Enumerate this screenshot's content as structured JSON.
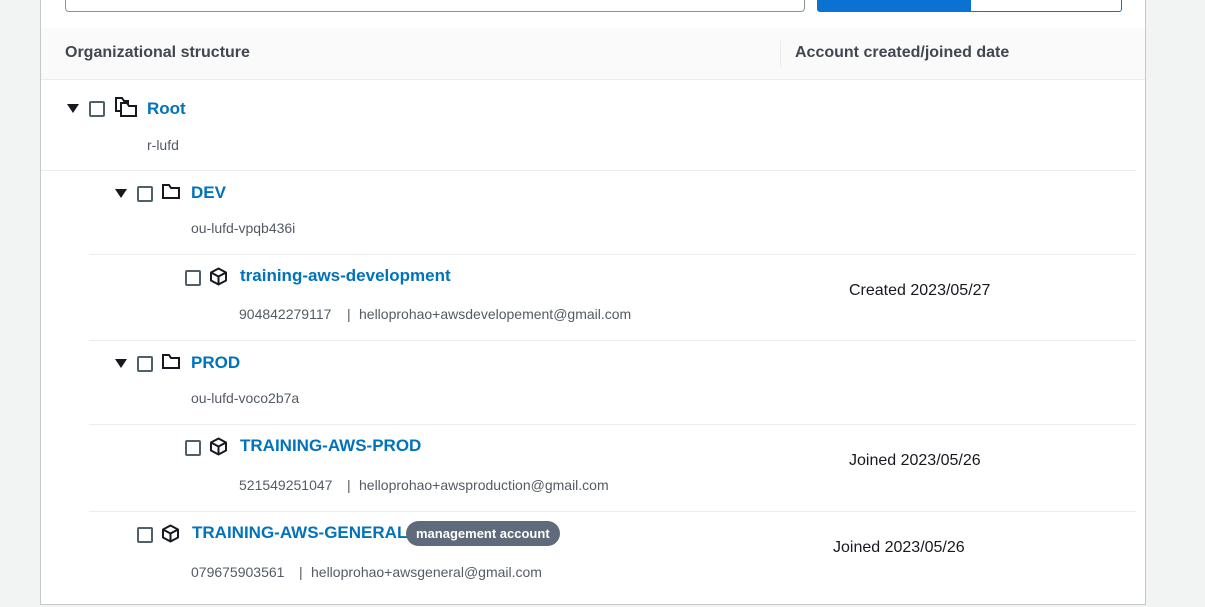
{
  "table": {
    "col_structure": "Organizational structure",
    "col_date": "Account created/joined date"
  },
  "root": {
    "name": "Root",
    "id": "r-lufd"
  },
  "dev": {
    "name": "DEV",
    "id": "ou-lufd-vpqb436i"
  },
  "dev_account": {
    "name": "training-aws-development",
    "account_id": "904842279117",
    "separator": "|",
    "email": "helloprohao+awsdevelopement@gmail.com",
    "date": "Created 2023/05/27"
  },
  "prod": {
    "name": "PROD",
    "id": "ou-lufd-voco2b7a"
  },
  "prod_account": {
    "name": "TRAINING-AWS-PROD",
    "account_id": "521549251047",
    "separator": "|",
    "email": "helloprohao+awsproduction@gmail.com",
    "date": "Joined 2023/05/26"
  },
  "general_account": {
    "name": "TRAINING-AWS-GENERAL",
    "badge": "management account",
    "account_id": "079675903561",
    "separator": "|",
    "email": "helloprohao+awsgeneral@gmail.com",
    "date": "Joined 2023/05/26"
  },
  "colors": {
    "link": "#0073bb",
    "primary": "#0972d3",
    "badge": "#5f6b7a"
  },
  "icons": [
    "search-icon",
    "caret-down-icon",
    "root-icon",
    "folder-icon",
    "account-icon"
  ]
}
